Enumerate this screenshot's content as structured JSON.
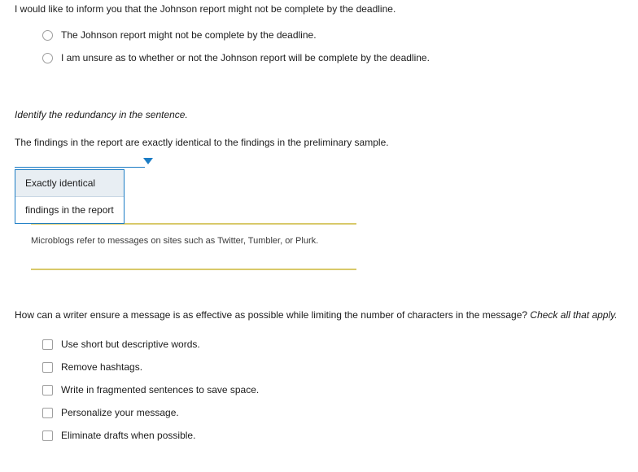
{
  "q1": {
    "intro": "I would like to inform you that the Johnson report might not be complete by the deadline.",
    "options": [
      "The Johnson report might not be complete by the deadline.",
      "I am unsure as to whether or not the Johnson report will be complete by the deadline."
    ]
  },
  "q2": {
    "prompt": "Identify the redundancy in the sentence.",
    "sentence": "The findings in the report are exactly identical to the findings in the preliminary sample.",
    "dropdown": {
      "options": [
        "Exactly identical",
        "findings in the report"
      ],
      "selected_index": 0
    }
  },
  "blurb": {
    "text": "Microblogs refer to messages on sites such as Twitter, Tumbler, or Plurk."
  },
  "q3": {
    "prompt_main": "How can a writer ensure a message is as effective as possible while limiting the number of characters in the message? ",
    "prompt_tail_italic": "Check all that apply.",
    "options": [
      "Use short but descriptive words.",
      "Remove hashtags.",
      "Write in fragmented sentences to save space.",
      "Personalize your message.",
      "Eliminate drafts when possible."
    ]
  }
}
